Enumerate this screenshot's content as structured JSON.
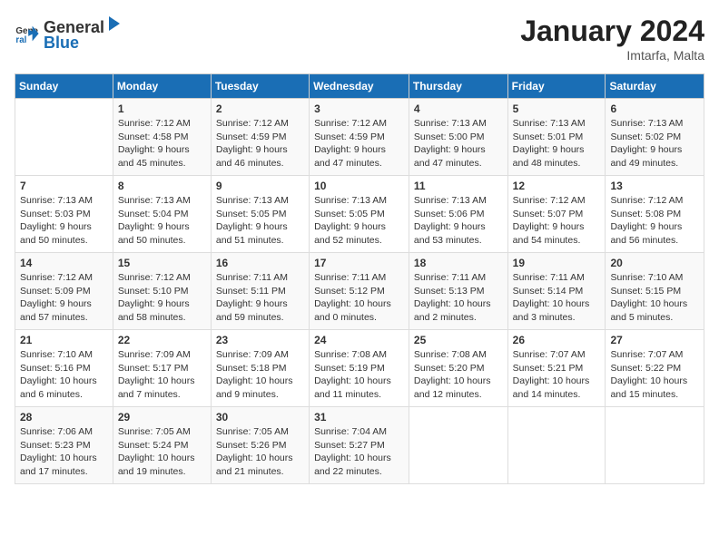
{
  "header": {
    "logo_line1": "General",
    "logo_line2": "Blue",
    "month_year": "January 2024",
    "location": "Imtarfa, Malta"
  },
  "days_of_week": [
    "Sunday",
    "Monday",
    "Tuesday",
    "Wednesday",
    "Thursday",
    "Friday",
    "Saturday"
  ],
  "weeks": [
    [
      {
        "day": "",
        "info": ""
      },
      {
        "day": "1",
        "info": "Sunrise: 7:12 AM\nSunset: 4:58 PM\nDaylight: 9 hours\nand 45 minutes."
      },
      {
        "day": "2",
        "info": "Sunrise: 7:12 AM\nSunset: 4:59 PM\nDaylight: 9 hours\nand 46 minutes."
      },
      {
        "day": "3",
        "info": "Sunrise: 7:12 AM\nSunset: 4:59 PM\nDaylight: 9 hours\nand 47 minutes."
      },
      {
        "day": "4",
        "info": "Sunrise: 7:13 AM\nSunset: 5:00 PM\nDaylight: 9 hours\nand 47 minutes."
      },
      {
        "day": "5",
        "info": "Sunrise: 7:13 AM\nSunset: 5:01 PM\nDaylight: 9 hours\nand 48 minutes."
      },
      {
        "day": "6",
        "info": "Sunrise: 7:13 AM\nSunset: 5:02 PM\nDaylight: 9 hours\nand 49 minutes."
      }
    ],
    [
      {
        "day": "7",
        "info": "Sunrise: 7:13 AM\nSunset: 5:03 PM\nDaylight: 9 hours\nand 50 minutes."
      },
      {
        "day": "8",
        "info": "Sunrise: 7:13 AM\nSunset: 5:04 PM\nDaylight: 9 hours\nand 50 minutes."
      },
      {
        "day": "9",
        "info": "Sunrise: 7:13 AM\nSunset: 5:05 PM\nDaylight: 9 hours\nand 51 minutes."
      },
      {
        "day": "10",
        "info": "Sunrise: 7:13 AM\nSunset: 5:05 PM\nDaylight: 9 hours\nand 52 minutes."
      },
      {
        "day": "11",
        "info": "Sunrise: 7:13 AM\nSunset: 5:06 PM\nDaylight: 9 hours\nand 53 minutes."
      },
      {
        "day": "12",
        "info": "Sunrise: 7:12 AM\nSunset: 5:07 PM\nDaylight: 9 hours\nand 54 minutes."
      },
      {
        "day": "13",
        "info": "Sunrise: 7:12 AM\nSunset: 5:08 PM\nDaylight: 9 hours\nand 56 minutes."
      }
    ],
    [
      {
        "day": "14",
        "info": "Sunrise: 7:12 AM\nSunset: 5:09 PM\nDaylight: 9 hours\nand 57 minutes."
      },
      {
        "day": "15",
        "info": "Sunrise: 7:12 AM\nSunset: 5:10 PM\nDaylight: 9 hours\nand 58 minutes."
      },
      {
        "day": "16",
        "info": "Sunrise: 7:11 AM\nSunset: 5:11 PM\nDaylight: 9 hours\nand 59 minutes."
      },
      {
        "day": "17",
        "info": "Sunrise: 7:11 AM\nSunset: 5:12 PM\nDaylight: 10 hours\nand 0 minutes."
      },
      {
        "day": "18",
        "info": "Sunrise: 7:11 AM\nSunset: 5:13 PM\nDaylight: 10 hours\nand 2 minutes."
      },
      {
        "day": "19",
        "info": "Sunrise: 7:11 AM\nSunset: 5:14 PM\nDaylight: 10 hours\nand 3 minutes."
      },
      {
        "day": "20",
        "info": "Sunrise: 7:10 AM\nSunset: 5:15 PM\nDaylight: 10 hours\nand 5 minutes."
      }
    ],
    [
      {
        "day": "21",
        "info": "Sunrise: 7:10 AM\nSunset: 5:16 PM\nDaylight: 10 hours\nand 6 minutes."
      },
      {
        "day": "22",
        "info": "Sunrise: 7:09 AM\nSunset: 5:17 PM\nDaylight: 10 hours\nand 7 minutes."
      },
      {
        "day": "23",
        "info": "Sunrise: 7:09 AM\nSunset: 5:18 PM\nDaylight: 10 hours\nand 9 minutes."
      },
      {
        "day": "24",
        "info": "Sunrise: 7:08 AM\nSunset: 5:19 PM\nDaylight: 10 hours\nand 11 minutes."
      },
      {
        "day": "25",
        "info": "Sunrise: 7:08 AM\nSunset: 5:20 PM\nDaylight: 10 hours\nand 12 minutes."
      },
      {
        "day": "26",
        "info": "Sunrise: 7:07 AM\nSunset: 5:21 PM\nDaylight: 10 hours\nand 14 minutes."
      },
      {
        "day": "27",
        "info": "Sunrise: 7:07 AM\nSunset: 5:22 PM\nDaylight: 10 hours\nand 15 minutes."
      }
    ],
    [
      {
        "day": "28",
        "info": "Sunrise: 7:06 AM\nSunset: 5:23 PM\nDaylight: 10 hours\nand 17 minutes."
      },
      {
        "day": "29",
        "info": "Sunrise: 7:05 AM\nSunset: 5:24 PM\nDaylight: 10 hours\nand 19 minutes."
      },
      {
        "day": "30",
        "info": "Sunrise: 7:05 AM\nSunset: 5:26 PM\nDaylight: 10 hours\nand 21 minutes."
      },
      {
        "day": "31",
        "info": "Sunrise: 7:04 AM\nSunset: 5:27 PM\nDaylight: 10 hours\nand 22 minutes."
      },
      {
        "day": "",
        "info": ""
      },
      {
        "day": "",
        "info": ""
      },
      {
        "day": "",
        "info": ""
      }
    ]
  ]
}
